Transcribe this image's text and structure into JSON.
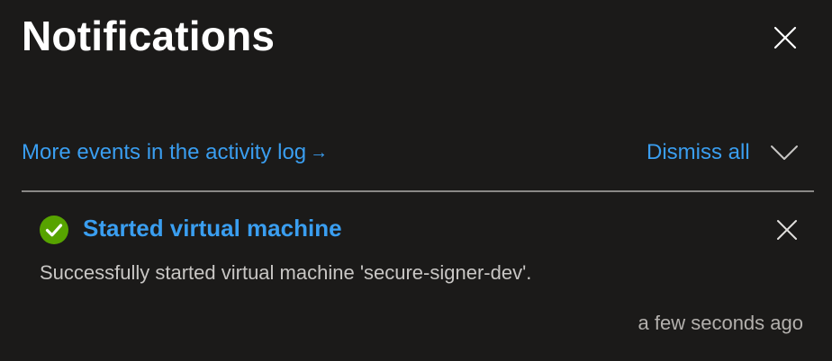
{
  "panel": {
    "title": "Notifications",
    "close_icon": "close-icon"
  },
  "actions": {
    "activity_log_link": "More events in the activity log",
    "activity_log_arrow": "→",
    "dismiss_all": "Dismiss all",
    "collapse_icon": "chevron-down-icon"
  },
  "notifications": [
    {
      "status": "success",
      "status_icon": "success-check-icon",
      "title": "Started virtual machine",
      "message": "Successfully started virtual machine 'secure-signer-dev'.",
      "time": "a few seconds ago",
      "close_icon": "close-icon"
    }
  ],
  "colors": {
    "background": "#1b1a19",
    "link": "#3a9ef0",
    "success": "#57a300",
    "divider": "#8a8886",
    "message_text": "#c8c6c4"
  }
}
